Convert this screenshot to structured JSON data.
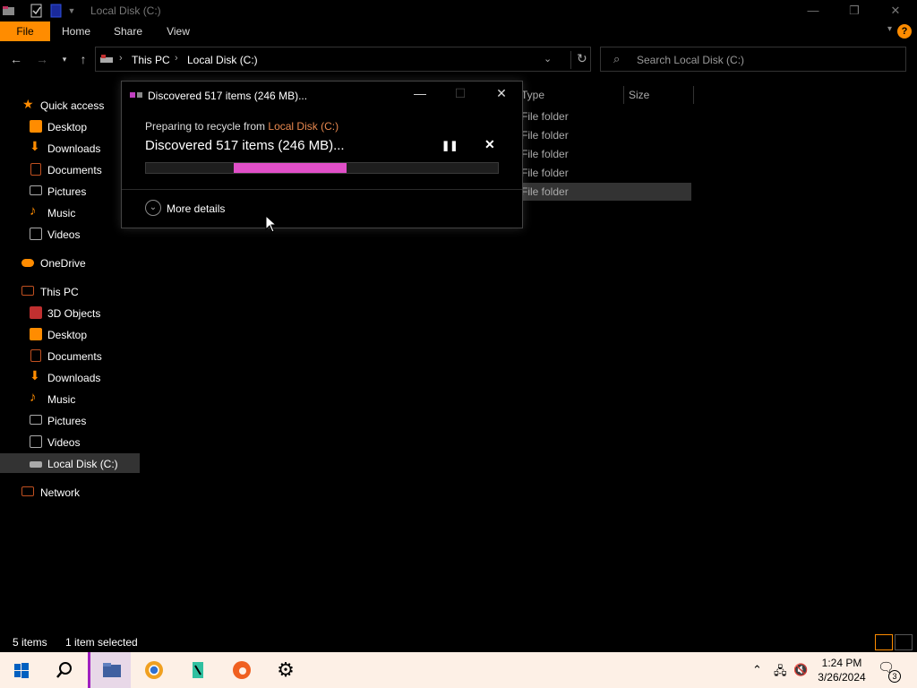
{
  "window": {
    "title": "Local Disk (C:)",
    "controls": {
      "minimize": "—",
      "maximize": "❐",
      "close": "✕"
    }
  },
  "ribbon": {
    "tabs": [
      "File",
      "Home",
      "Share",
      "View"
    ],
    "help": "?"
  },
  "address_bar": {
    "crumbs": [
      "This PC",
      "Local Disk (C:)"
    ],
    "search_placeholder": "Search Local Disk (C:)"
  },
  "sidebar": {
    "items": [
      {
        "label": "Quick access",
        "icon": "star-icon",
        "color": "#ff8c00"
      },
      {
        "label": "Desktop",
        "icon": "desktop-icon",
        "color": "#ff8c00"
      },
      {
        "label": "Downloads",
        "icon": "download-icon",
        "color": "#ff8c00"
      },
      {
        "label": "Documents",
        "icon": "document-icon",
        "color": "#c05020"
      },
      {
        "label": "Pictures",
        "icon": "pictures-icon",
        "color": "#aaaaaa"
      },
      {
        "label": "Music",
        "icon": "music-icon",
        "color": "#ff8c00"
      },
      {
        "label": "Videos",
        "icon": "videos-icon",
        "color": "#aaaaaa"
      },
      {
        "label": "OneDrive",
        "icon": "cloud-icon",
        "color": "#ff8c00"
      },
      {
        "label": "This PC",
        "icon": "computer-icon",
        "color": "#c05020"
      },
      {
        "label": "3D Objects",
        "icon": "cube-icon",
        "color": "#c03030"
      },
      {
        "label": "Desktop",
        "icon": "desktop-icon",
        "color": "#ff8c00"
      },
      {
        "label": "Documents",
        "icon": "document-icon",
        "color": "#c05020"
      },
      {
        "label": "Downloads",
        "icon": "download-icon",
        "color": "#ff8c00"
      },
      {
        "label": "Music",
        "icon": "music-icon",
        "color": "#ff8c00"
      },
      {
        "label": "Pictures",
        "icon": "pictures-icon",
        "color": "#aaaaaa"
      },
      {
        "label": "Videos",
        "icon": "videos-icon",
        "color": "#aaaaaa"
      },
      {
        "label": "Local Disk (C:)",
        "icon": "drive-icon",
        "color": "#aaaaaa",
        "selected": true
      },
      {
        "label": "Network",
        "icon": "network-icon",
        "color": "#c05020"
      }
    ]
  },
  "file_list": {
    "columns": [
      "Type",
      "Size"
    ],
    "rows": [
      {
        "type": "File folder"
      },
      {
        "type": "File folder"
      },
      {
        "type": "File folder"
      },
      {
        "type": "File folder"
      },
      {
        "type": "File folder",
        "selected": true
      }
    ]
  },
  "dialog": {
    "title": "Discovered 517 items (246 MB)...",
    "subline_prefix": "Preparing to recycle from ",
    "subline_location": "Local Disk (C:)",
    "headline": "Discovered 517 items (246 MB)...",
    "progress_color": "#e04fc8",
    "progress_indeterminate_segment": [
      0.25,
      0.57
    ],
    "more_details": "More details",
    "pause_symbol": "❚❚",
    "cancel_symbol": "✕"
  },
  "status_bar": {
    "item_count": "5 items",
    "selection": "1 item selected"
  },
  "taskbar": {
    "apps": [
      "start-icon",
      "search-icon",
      "file-explorer-icon",
      "chrome-icon",
      "notepad-icon",
      "edge-icon",
      "settings-icon"
    ],
    "time": "1:24 PM",
    "date": "3/26/2024",
    "notification_count": "3"
  }
}
